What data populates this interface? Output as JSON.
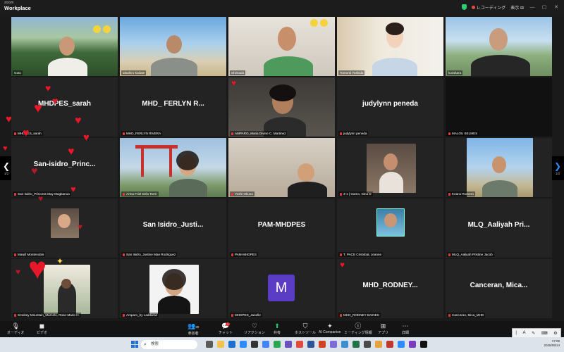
{
  "app": {
    "brand_top": "zoom",
    "brand_bottom": "Workplace"
  },
  "titlebar": {
    "recording_label": "レコーディング",
    "view_label": "表示"
  },
  "tiles": [
    {
      "id": "goto",
      "name": "Goto"
    },
    {
      "id": "kodate",
      "name": "takahiro kodate"
    },
    {
      "id": "shimada",
      "name": "Shimada"
    },
    {
      "id": "tomomi",
      "name": "Tomomi Yoshida"
    },
    {
      "id": "kurahara",
      "name": "kurahara"
    },
    {
      "id": "sarah",
      "name": "MHDPES_sarah",
      "big": "MHDPES_sarah"
    },
    {
      "id": "ferlyn",
      "name": "MHD_FERLYN RIVERA",
      "big": "MHD_ FERLYN R..."
    },
    {
      "id": "amparo",
      "name": "AMPARO_Maria Divine C. Martinez"
    },
    {
      "id": "judylynn",
      "name": "judylynn peneda",
      "big": "judylynn peneda"
    },
    {
      "id": "malou",
      "name": "MALOU BELMES"
    },
    {
      "id": "princess",
      "name": "San-isidro_Princess May Magbanua",
      "big": "San-isidro_Princ..."
    },
    {
      "id": "arma",
      "name": "Arma Friel Dela Torre"
    },
    {
      "id": "okuno",
      "name": "Yoshi Okuno"
    },
    {
      "id": "gemo",
      "name": "3-1 | Gamo, Gina D"
    },
    {
      "id": "romero",
      "name": "Keano Romero"
    },
    {
      "id": "maryll",
      "name": "Maryll Montenubis"
    },
    {
      "id": "justine",
      "name": "San Isidro_Justine Mae Rodriguez",
      "big": "San Isidro_Justi..."
    },
    {
      "id": "pam",
      "name": "PAM-MHDPES",
      "big": "PAM-MHDPES"
    },
    {
      "id": "jeanne",
      "name": "T. PACE Cristobal, Jeanne"
    },
    {
      "id": "aaliyah",
      "name": "MLQ_Aaliyah Pristine Jacob",
      "big": "MLQ_Aaliyah Pri..."
    },
    {
      "id": "smokey",
      "name": "Smokey Mountain_Marcelo, Rose-Marie H."
    },
    {
      "id": "laddaran",
      "name": "Amparo_by Laddaran"
    },
    {
      "id": "janelle",
      "name": "MHDPES_Janelle",
      "avatar": "M"
    },
    {
      "id": "rodney",
      "name": "MHD_RODNEY BAINES",
      "big": "MHD_RODNEY..."
    },
    {
      "id": "canceran",
      "name": "Canceran, Mica_MHD",
      "big": "Canceran, Mica..."
    }
  ],
  "pager": {
    "left": "1/2",
    "right": "1/2"
  },
  "toolbar": {
    "audio": "オーディオ",
    "video": "ビデオ",
    "participants": "参加者",
    "participants_count": "30",
    "chat": "チャット",
    "chat_badge": "1",
    "reactions": "リアクション",
    "share": "共有",
    "host_tools": "ホストツール",
    "ai_companion": "AI Companion",
    "meeting_info": "ミーティング情報",
    "apps": "アプリ",
    "more": "詳細"
  },
  "taskbar": {
    "search_placeholder": "検索",
    "time": "17:06",
    "date": "2025/09/14"
  },
  "ime": {
    "mode": "A"
  },
  "colors": {
    "accent": "#2d8cff",
    "active_speaker": "#3fd35c",
    "recording": "#e74c3c",
    "heart": "#e8182b"
  }
}
